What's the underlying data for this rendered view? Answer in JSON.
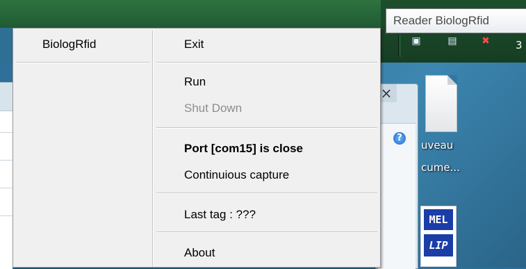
{
  "tooltip": {
    "text": "Reader BiologRfid"
  },
  "menu": {
    "column_left": {
      "header": "BiologRfid"
    },
    "items": {
      "exit": "Exit",
      "run": "Run",
      "shutdown": "Shut Down",
      "port_status": "Port [com15] is close",
      "continuous": "Continuious capture",
      "last_tag": "Last tag : ???",
      "about": "About"
    }
  },
  "desktop": {
    "clock_fragment": "3",
    "icon_label_line1": "uveau",
    "icon_label_line2": "cume...",
    "badge_top": "MEL",
    "badge_bottom": "LIP"
  }
}
